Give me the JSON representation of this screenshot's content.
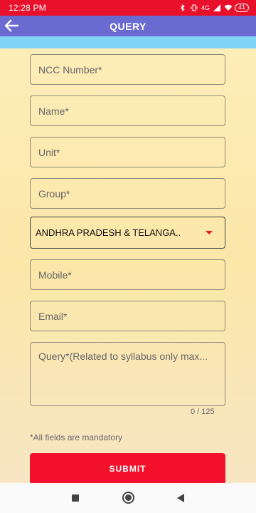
{
  "status_bar": {
    "time": "12:28 PM",
    "network": "4G",
    "battery": "41"
  },
  "app_bar": {
    "title": "QUERY"
  },
  "form": {
    "ncc_number_placeholder": "NCC Number*",
    "name_placeholder": "Name*",
    "unit_placeholder": "Unit*",
    "group_placeholder": "Group*",
    "directorate_value": "ANDHRA PRADESH & TELANGA..",
    "mobile_placeholder": "Mobile*",
    "email_placeholder": "Email*",
    "query_placeholder": "Query*(Related to syllabus only max...",
    "query_counter": "0 / 125",
    "mandatory_note": "*All fields are mandatory",
    "submit_label": "SUBMIT"
  },
  "colors": {
    "status_bar": "#e8102a",
    "app_bar": "#6a6ad0",
    "accent_strip": "#7fd3f5",
    "submit": "#f2102a",
    "background": "#fdedb8"
  },
  "icons": {
    "back": "arrow-left-icon",
    "dropdown": "caret-down-icon"
  }
}
